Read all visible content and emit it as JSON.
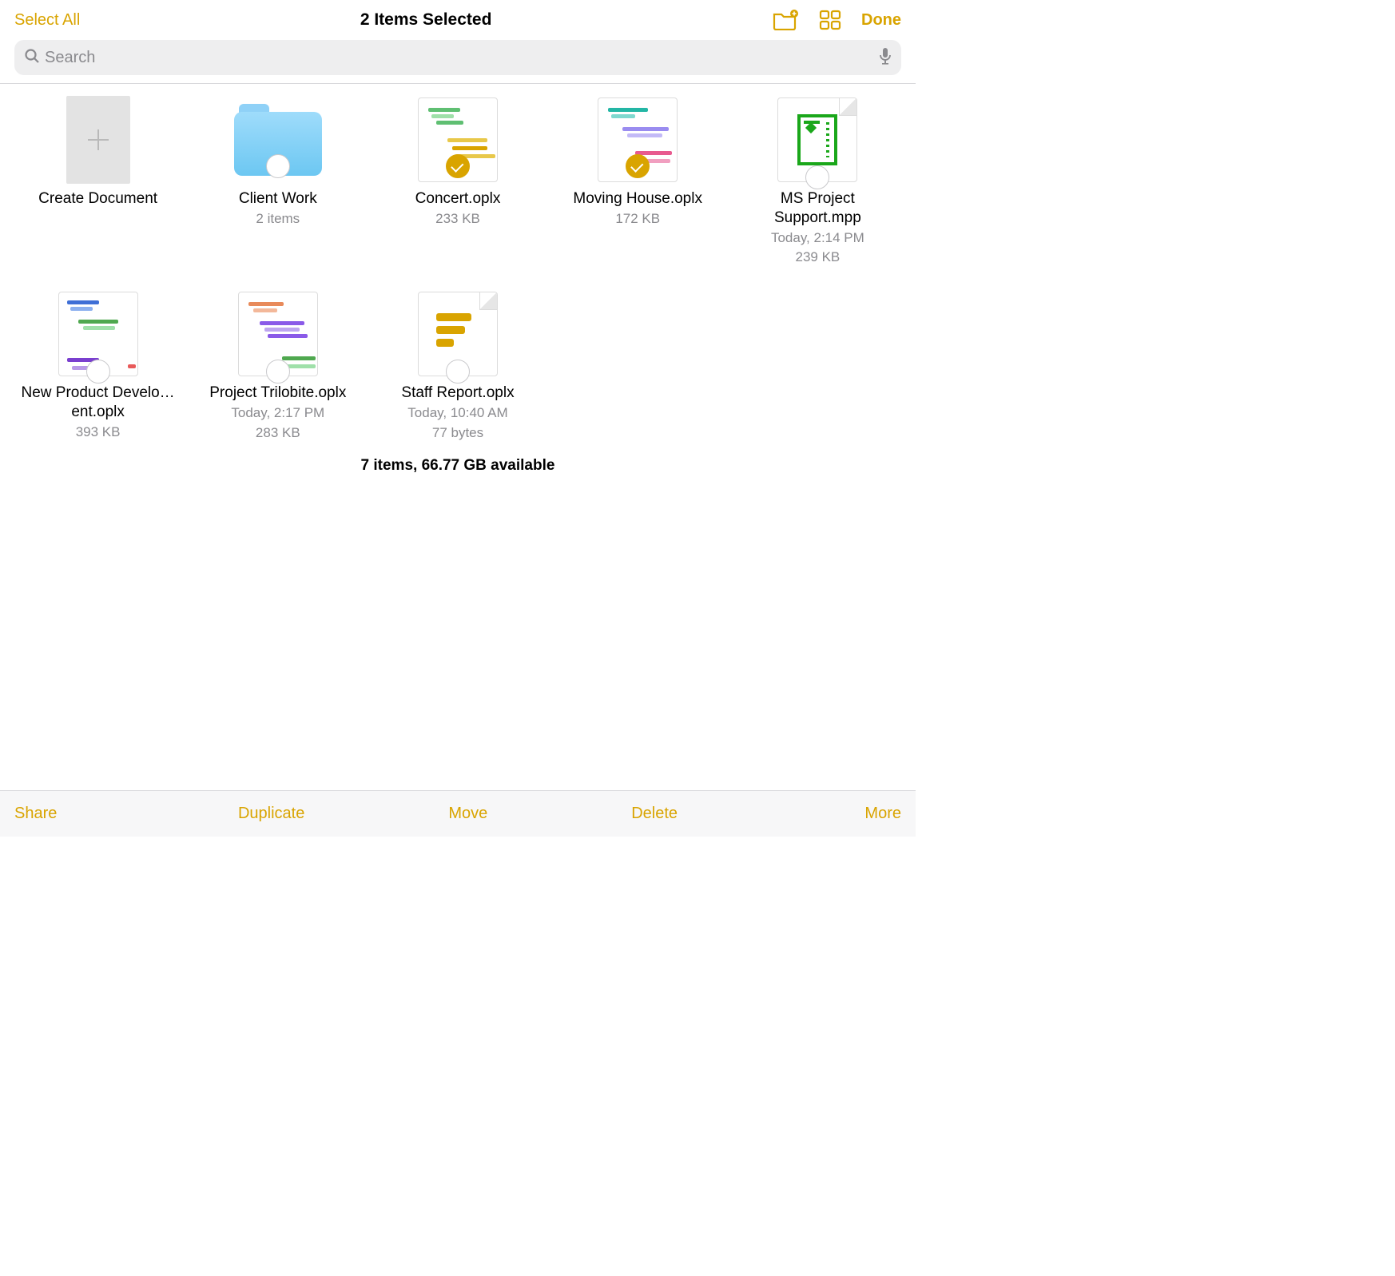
{
  "header": {
    "select_all": "Select All",
    "title": "2 Items Selected",
    "done": "Done"
  },
  "search": {
    "placeholder": "Search"
  },
  "create_label": "Create Document",
  "items": [
    {
      "name": "Client Work",
      "meta1": "2 items",
      "meta2": "",
      "type": "folder",
      "selected": false
    },
    {
      "name": "Concert.oplx",
      "meta1": "233 KB",
      "meta2": "",
      "type": "gantt-green",
      "selected": true
    },
    {
      "name": "Moving House.oplx",
      "meta1": "172 KB",
      "meta2": "",
      "type": "gantt-teal",
      "selected": true
    },
    {
      "name": "MS Project Support.mpp",
      "meta1": "Today, 2:14 PM",
      "meta2": "239 KB",
      "type": "msproject",
      "selected": false
    },
    {
      "name": "New Product Develo…ent.oplx",
      "meta1": "393 KB",
      "meta2": "",
      "type": "gantt-blue",
      "selected": false
    },
    {
      "name": "Project Trilobite.oplx",
      "meta1": "Today, 2:17 PM",
      "meta2": "283 KB",
      "type": "gantt-purple",
      "selected": false
    },
    {
      "name": "Staff Report.oplx",
      "meta1": "Today, 10:40 AM",
      "meta2": "77 bytes",
      "type": "staff",
      "selected": false
    }
  ],
  "status": "7 items, 66.77 GB available",
  "toolbar": {
    "share": "Share",
    "duplicate": "Duplicate",
    "move": "Move",
    "delete": "Delete",
    "more": "More"
  }
}
